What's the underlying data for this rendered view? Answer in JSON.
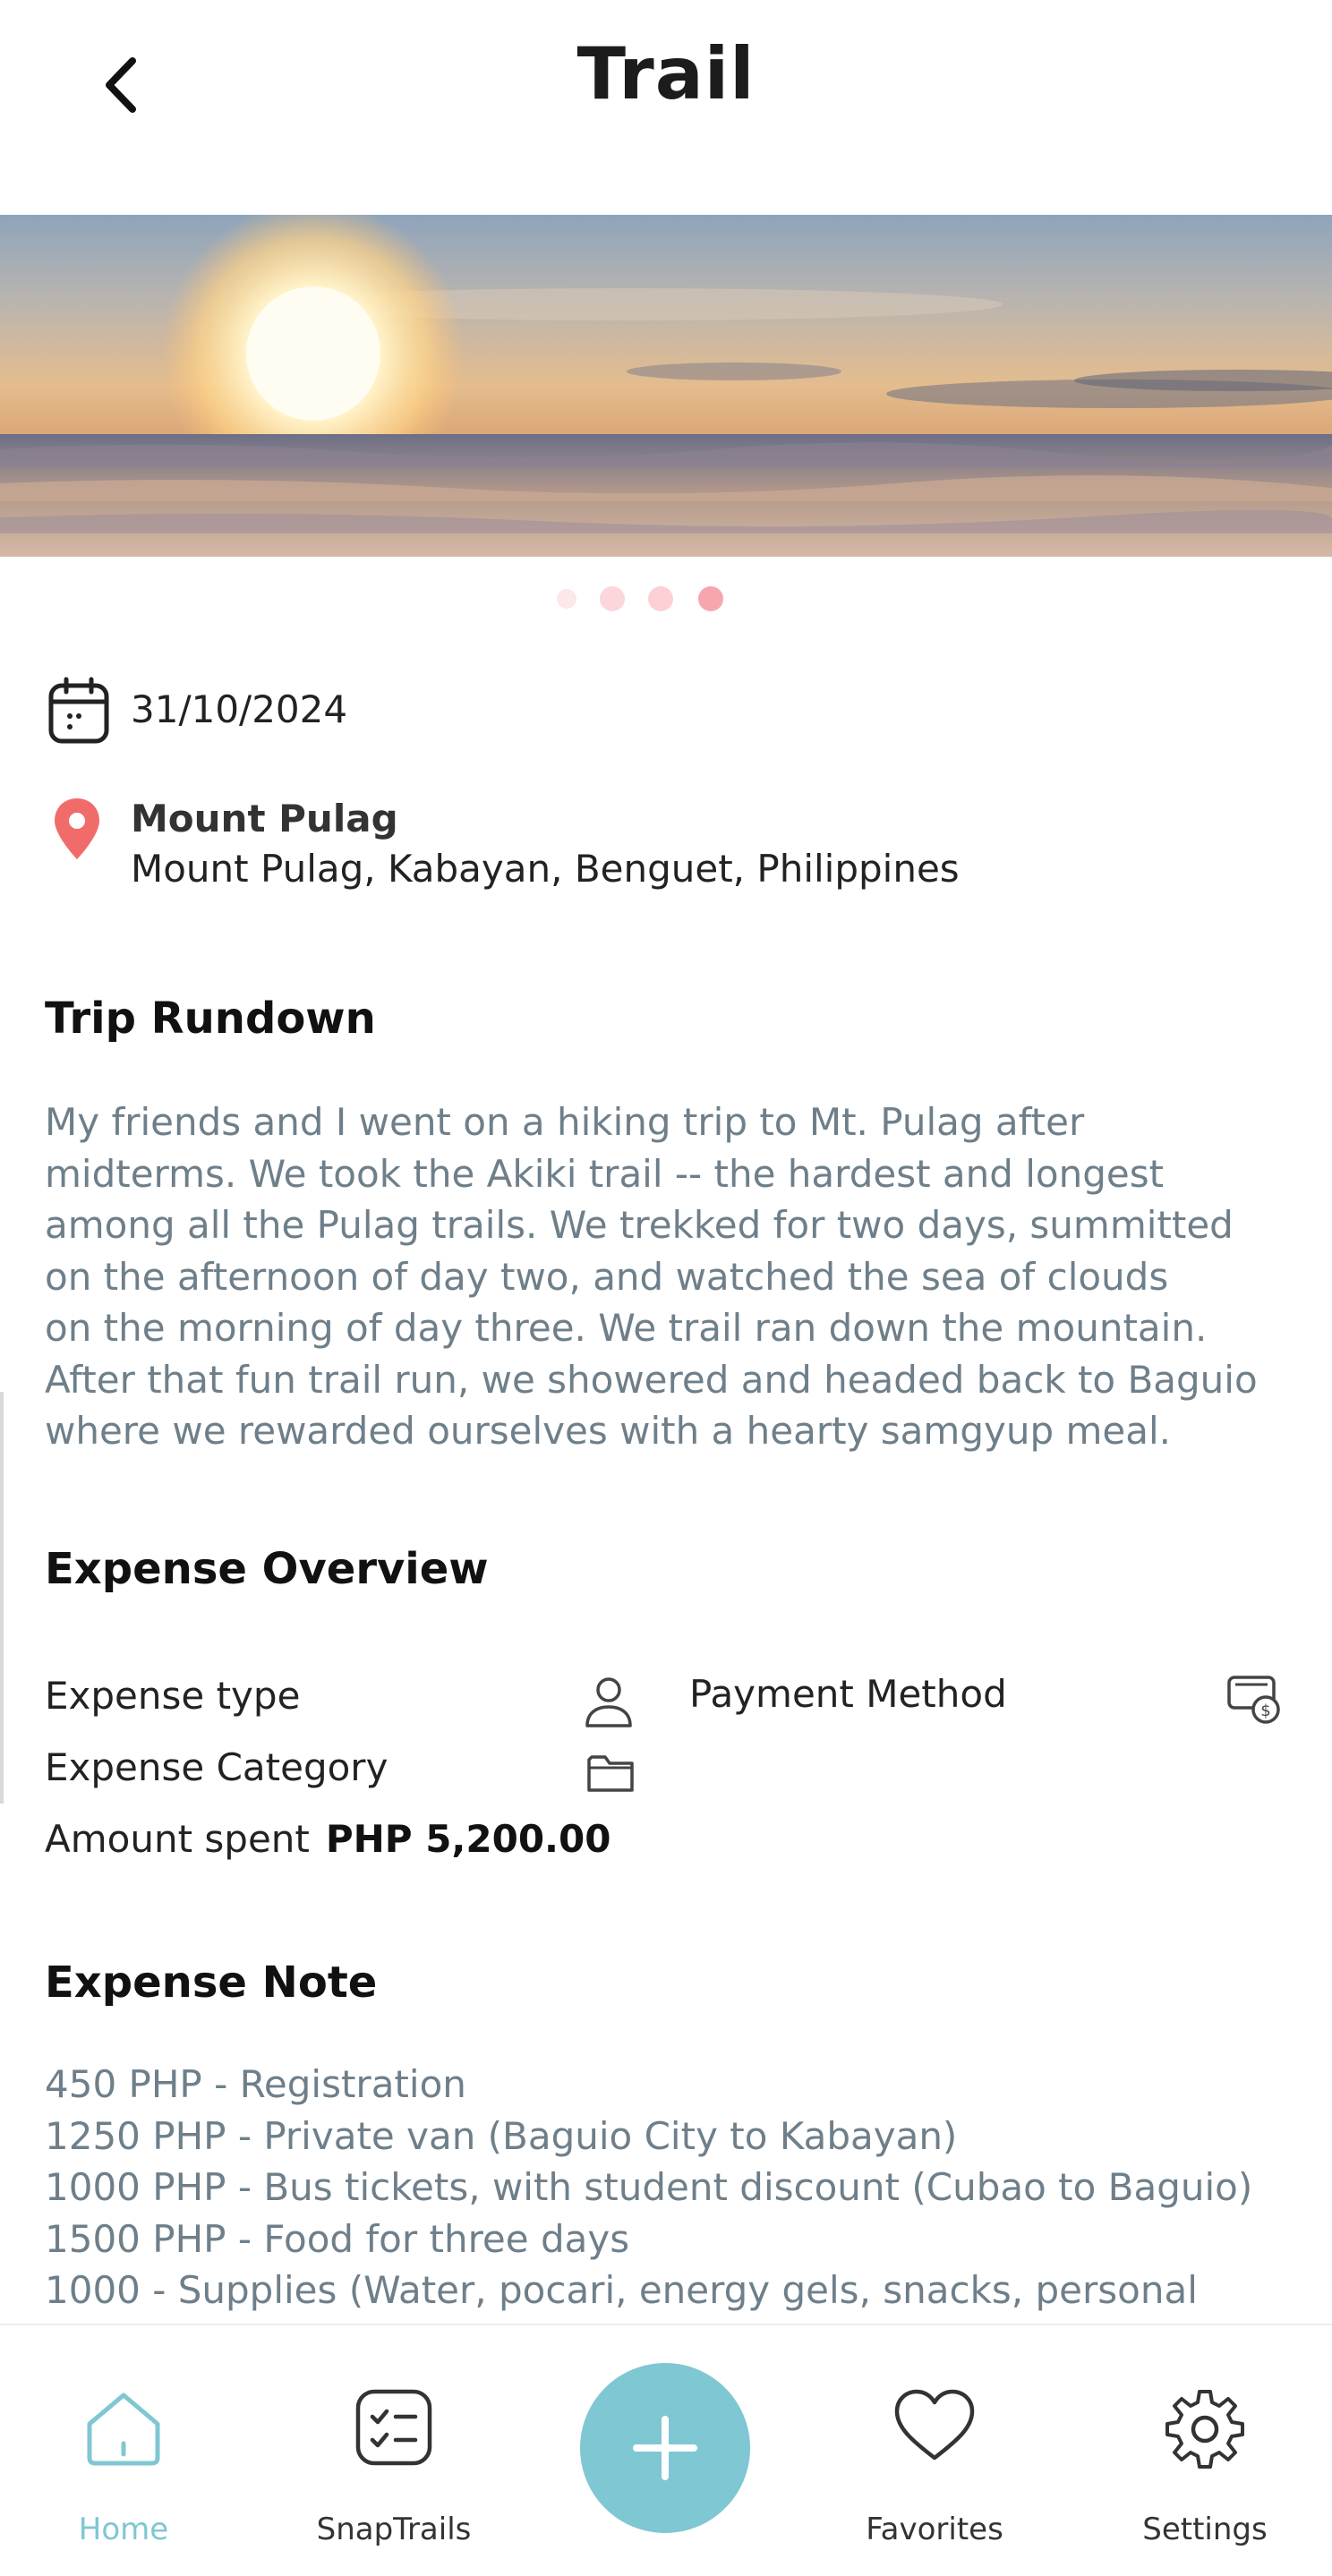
{
  "header": {
    "title": "Trail"
  },
  "hero": {
    "carousel_active_index": 3,
    "carousel_count": 4
  },
  "trail": {
    "date": "31/10/2024",
    "location_name": "Mount Pulag",
    "location_address": "Mount Pulag, Kabayan, Benguet, Philippines"
  },
  "rundown": {
    "heading": "Trip Rundown",
    "text": "My friends and I went on a hiking trip to Mt. Pulag after\nmidterms. We took the Akiki trail -- the hardest and longest\namong all the Pulag trails. We trekked for two days, summitted\non the afternoon of day two, and watched the sea of clouds\non the morning of day three. We trail ran down the mountain.\nAfter that fun trail run, we showered and headed back to Baguio\nwhere we rewarded ourselves with a hearty samgyup meal."
  },
  "expense": {
    "heading": "Expense Overview",
    "type_label": "Expense type",
    "payment_label": "Payment Method",
    "category_label": "Expense Category",
    "amount_label": "Amount spent",
    "amount_value": "PHP 5,200.00"
  },
  "note": {
    "heading": "Expense Note",
    "lines": [
      "450 PHP - Registration",
      "1250 PHP - Private van (Baguio City to Kabayan)",
      "1000 PHP - Bus tickets, with student discount (Cubao to Baguio)",
      "1500 PHP - Food for three days",
      "1000 - Supplies (Water, pocari, energy gels, snacks, personal"
    ]
  },
  "nav": {
    "home": "Home",
    "snaptrails": "SnapTrails",
    "favorites": "Favorites",
    "settings": "Settings",
    "active": "home",
    "accent_color": "#7fc7d3"
  },
  "icons": {
    "back": "chevron-left-icon",
    "date": "calendar-icon",
    "location": "map-pin-icon",
    "expense_type": "user-icon",
    "category": "folder-icon",
    "payment": "cash-icon",
    "home": "home-icon",
    "snaptrails": "checklist-icon",
    "add": "plus-icon",
    "favorites": "heart-icon",
    "settings": "gear-icon"
  }
}
